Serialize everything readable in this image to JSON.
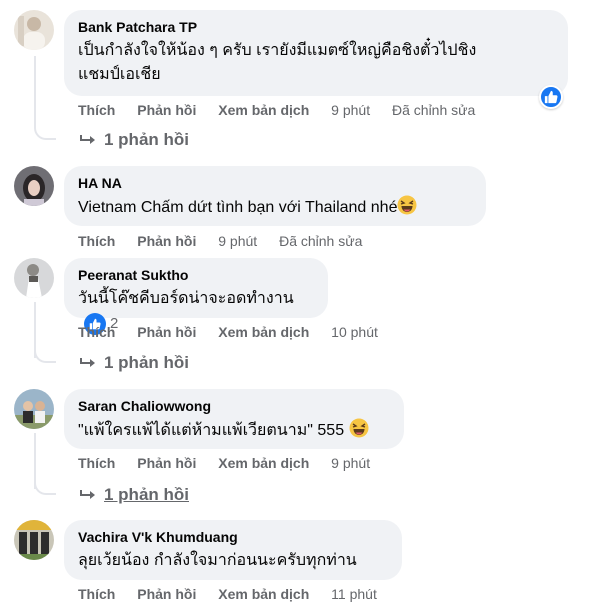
{
  "actions": {
    "like": "Thích",
    "reply": "Phản hồi",
    "translate": "Xem bản dịch"
  },
  "comments": [
    {
      "author": "Bank Patchara TP",
      "text_line1": "เป็นกำลังใจให้น้อง ๆ ครับ เรายังมีแมตซ์ใหญ่คือชิงตั๋วไปชิง",
      "text_line2": "แชมป์เอเชีย",
      "time": "9 phút",
      "edited": "Đã chỉnh sửa",
      "replies": "1 phản hồi",
      "reaction": "like"
    },
    {
      "author": "HA NA",
      "text": "Vietnam Chấm dứt tình bạn với Thailand nhé",
      "emoji": "laughing",
      "time": "9 phút",
      "edited": "Đã chỉnh sửa"
    },
    {
      "author": "Peeranat Suktho",
      "text": "วันนี้โค๊ชคีบอร์ดน่าจะอดทำงาน",
      "reaction": "like",
      "reaction_count": "2",
      "time": "10 phút",
      "replies": "1 phản hồi"
    },
    {
      "author": "Saran Chaliowwong",
      "text": "\"แพ้ใครแพ้ได้แต่ห้ามแพ้เวียตนาม\" 555",
      "emoji": "laughing",
      "time": "9 phút",
      "replies": "1 phản hồi"
    },
    {
      "author": "Vachira V'k Khumduang",
      "text": "ลุยเว้ยน้อง กำลังใจมาก่อนนะครับทุกท่าน",
      "time": "11 phút"
    }
  ],
  "colors": {
    "bubble": "#f0f2f5",
    "meta": "#65676b",
    "like_blue": "#1877f2",
    "thread_line": "#e4e6eb"
  }
}
